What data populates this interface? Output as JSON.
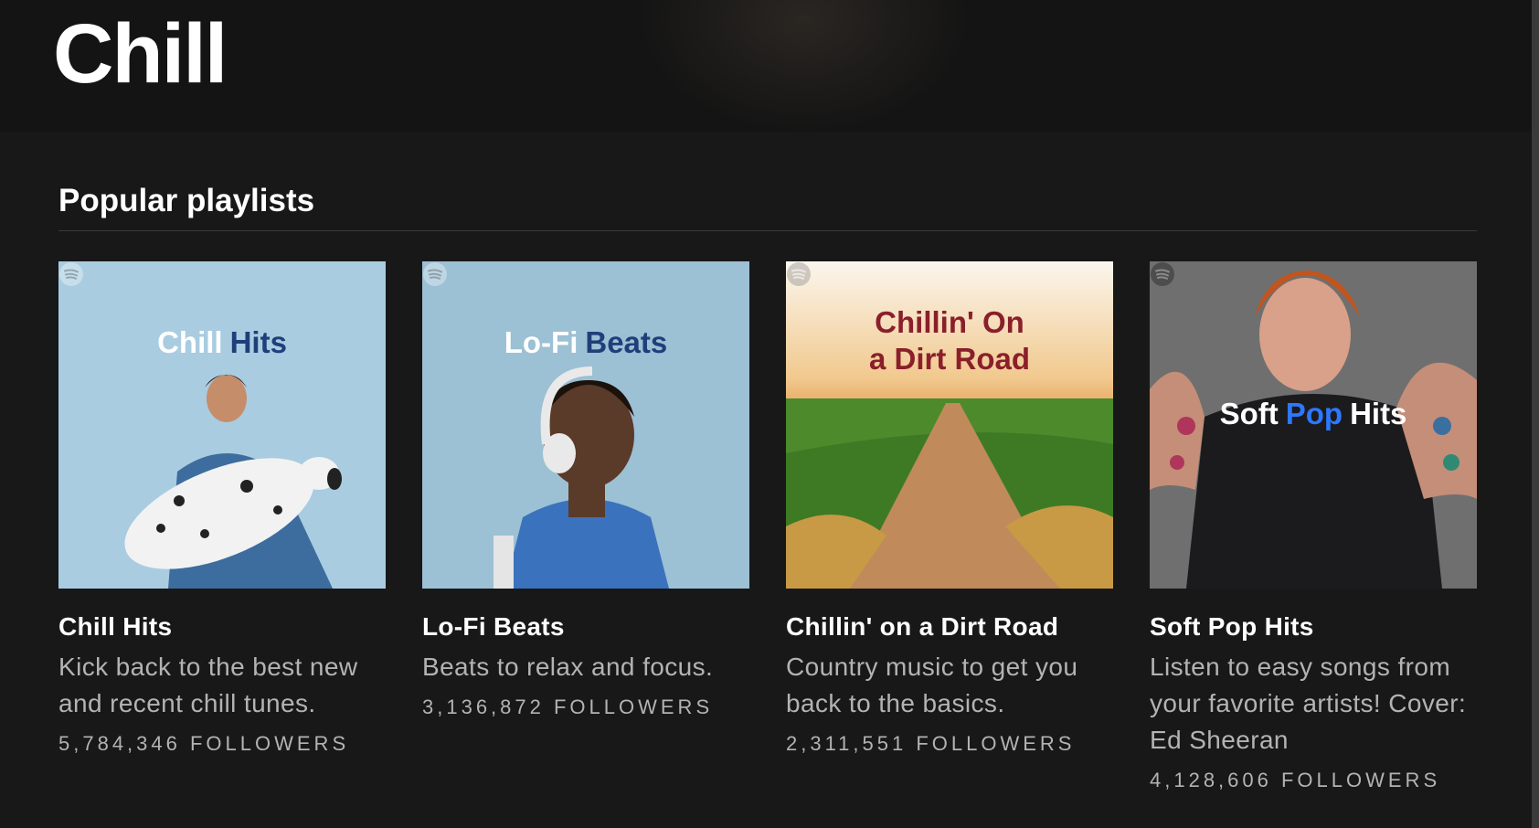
{
  "page": {
    "title": "Chill"
  },
  "section": {
    "title": "Popular playlists"
  },
  "playlists": [
    {
      "cover_text": [
        "Chill",
        "Hits"
      ],
      "title": "Chill Hits",
      "description": "Kick back to the best new and recent chill tunes.",
      "followers": "5,784,346 FOLLOWERS",
      "cover_color": "#a9cce0"
    },
    {
      "cover_text": [
        "Lo-Fi",
        "Beats"
      ],
      "title": "Lo-Fi Beats",
      "description": "Beats to relax and focus.",
      "followers": "3,136,872 FOLLOWERS",
      "cover_color": "#9cc0d4"
    },
    {
      "cover_text": [
        "Chillin' On",
        "a Dirt Road"
      ],
      "title": "Chillin' on a Dirt Road",
      "description": "Country music to get you back to the basics.",
      "followers": "2,311,551 FOLLOWERS",
      "cover_color": "#f3e7cf"
    },
    {
      "cover_text": [
        "Soft",
        "Pop",
        "Hits"
      ],
      "title": "Soft Pop Hits",
      "description": "Listen to easy songs from your favorite artists! Cover: Ed Sheeran",
      "followers": "4,128,606 FOLLOWERS",
      "cover_color": "#6f6f6f"
    }
  ],
  "colors": {
    "background": "#181818",
    "header": "#141414",
    "text_primary": "#ffffff",
    "text_secondary": "#b3b3b3",
    "accent_navy": "#1e3f7a",
    "accent_maroon": "#8a1f2b",
    "accent_blue": "#2e77ff"
  },
  "icons": [
    "spotify-logo-icon"
  ]
}
